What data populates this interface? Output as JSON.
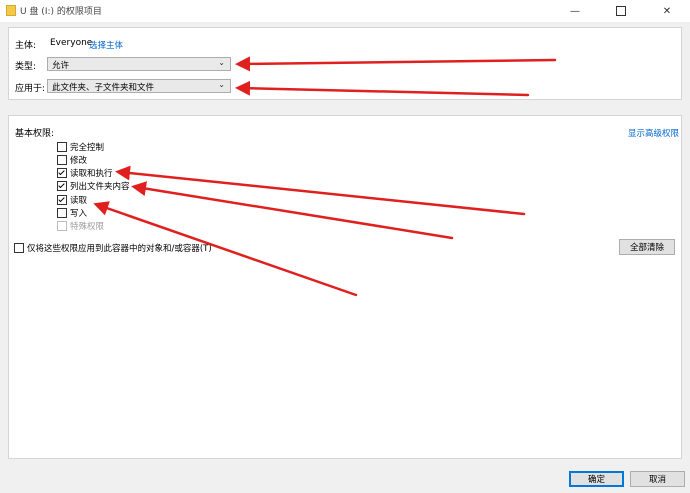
{
  "window": {
    "title": "U 盘 (I:) 的权限项目",
    "minimize_glyph": "—",
    "close_glyph": "✕"
  },
  "principal": {
    "label": "主体:",
    "value": "Everyone",
    "select_link": "选择主体"
  },
  "type": {
    "label": "类型:",
    "selected": "允许"
  },
  "applies_to": {
    "label": "应用于:",
    "selected": "此文件夹、子文件夹和文件"
  },
  "permissions": {
    "heading": "基本权限:",
    "advanced_link": "显示高级权限",
    "items": [
      {
        "label": "完全控制",
        "checked": false,
        "disabled": false
      },
      {
        "label": "修改",
        "checked": false,
        "disabled": false
      },
      {
        "label": "读取和执行",
        "checked": true,
        "disabled": false
      },
      {
        "label": "列出文件夹内容",
        "checked": true,
        "disabled": false
      },
      {
        "label": "读取",
        "checked": true,
        "disabled": false
      },
      {
        "label": "写入",
        "checked": false,
        "disabled": false
      },
      {
        "label": "特殊权限",
        "checked": false,
        "disabled": true
      }
    ]
  },
  "apply_only": {
    "label": "仅将这些权限应用到此容器中的对象和/或容器(T)",
    "checked": false
  },
  "buttons": {
    "clear_all": "全部清除",
    "ok": "确定",
    "cancel": "取消"
  },
  "icons": {
    "folder": "folder-icon",
    "dropdown": "chevron-down-icon"
  },
  "colors": {
    "link": "#0066cc",
    "annotation_arrow": "#e0201f"
  }
}
